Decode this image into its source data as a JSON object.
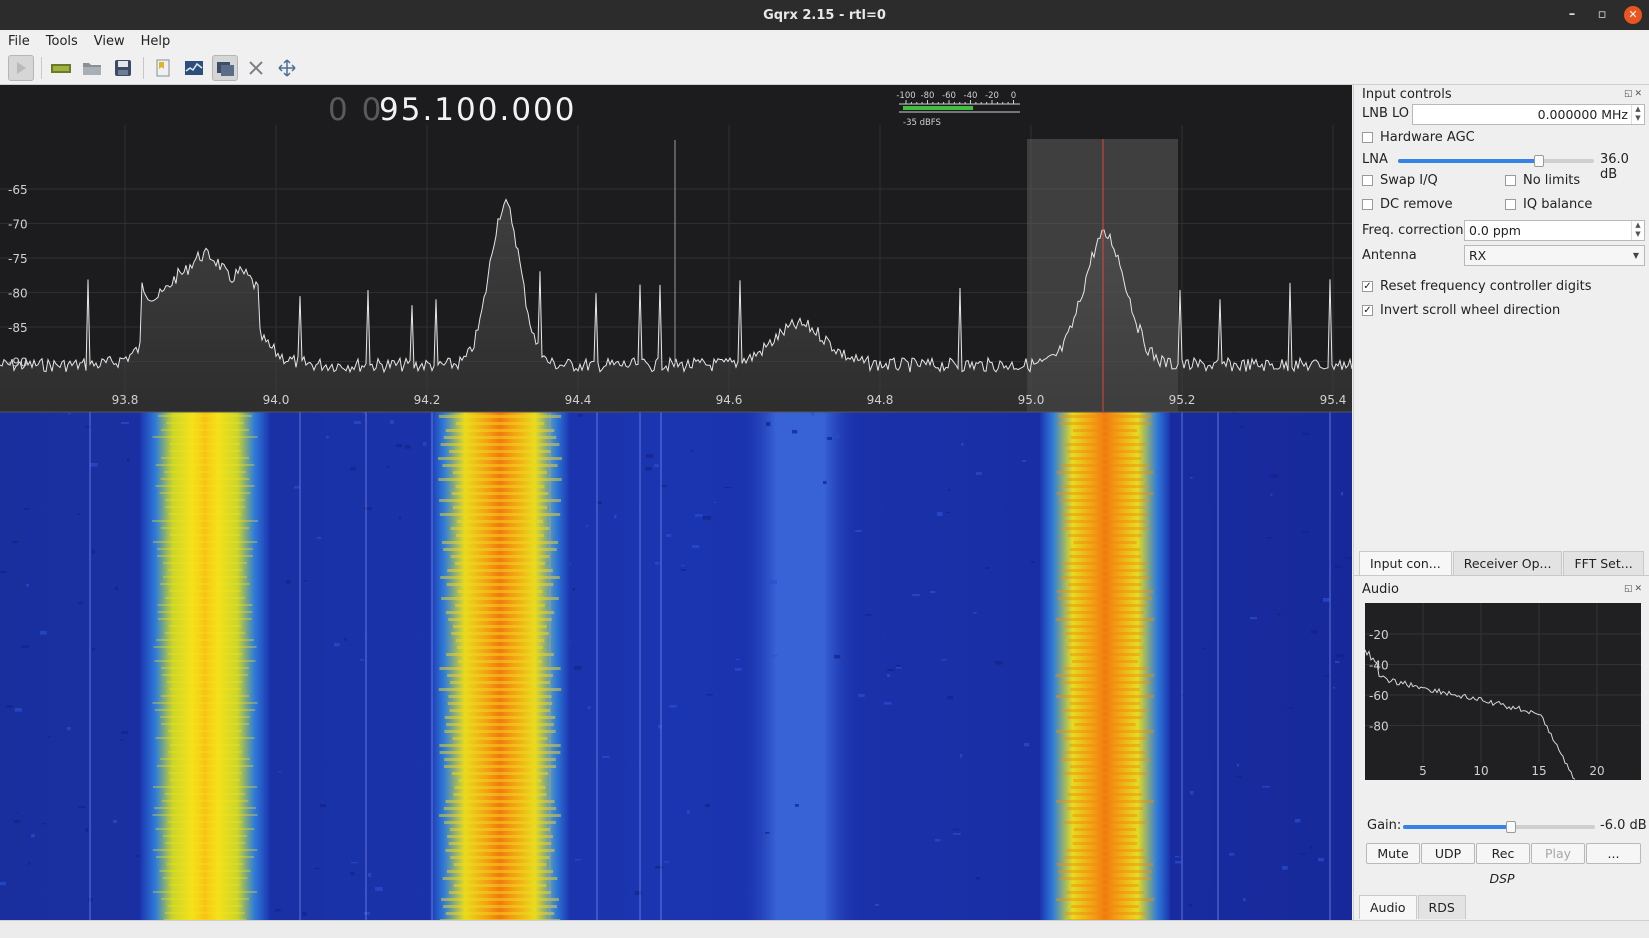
{
  "window": {
    "title": "Gqrx 2.15 - rtl=0"
  },
  "menu": [
    "File",
    "Tools",
    "View",
    "Help"
  ],
  "toolbar": [
    "play-icon",
    "device-icon",
    "open-icon",
    "save-icon",
    "bookmark-icon",
    "fft-icon",
    "remote-icon",
    "tools-icon",
    "fit-icon"
  ],
  "frequency": {
    "dim": "0 0",
    "value": "95.100.000"
  },
  "meter": {
    "scale": [
      "-100",
      "-80",
      "-60",
      "-40",
      "-20",
      "0"
    ],
    "level_text": "-35 dBFS",
    "level_fraction": 0.61
  },
  "spectrum": {
    "y_ticks": [
      "-65",
      "-70",
      "-75",
      "-80",
      "-85",
      "-90"
    ],
    "x_ticks": [
      "93.8",
      "94.0",
      "94.2",
      "94.4",
      "94.6",
      "94.8",
      "95.0",
      "95.2",
      "95.4"
    ]
  },
  "input_controls": {
    "title": "Input controls",
    "lnb_label": "LNB LO",
    "lnb_value": "0.000000 MHz",
    "hardware_agc": "Hardware AGC",
    "lna_label": "LNA",
    "lna_value": "36.0 dB",
    "lna_fraction": 0.72,
    "swap_iq": "Swap I/Q",
    "no_limits": "No limits",
    "dc_remove": "DC remove",
    "iq_balance": "IQ balance",
    "freq_corr_label": "Freq. correction",
    "freq_corr_value": "0.0 ppm",
    "antenna_label": "Antenna",
    "antenna_value": "RX",
    "reset_digits": "Reset frequency controller digits",
    "invert_scroll": "Invert scroll wheel direction",
    "check_mark": "✓"
  },
  "panel_tabs": [
    "Input con...",
    "Receiver Op...",
    "FFT Set..."
  ],
  "audio": {
    "title": "Audio",
    "y_ticks": [
      "-20",
      "-40",
      "-60",
      "-80"
    ],
    "x_ticks": [
      "5",
      "10",
      "15",
      "20"
    ],
    "gain_label": "Gain:",
    "gain_value": "-6.0 dB",
    "gain_fraction": 0.56,
    "buttons": [
      "Mute",
      "UDP",
      "Rec",
      "Play",
      "..."
    ],
    "dsp_label": "DSP",
    "tabs": [
      "Audio",
      "RDS"
    ]
  }
}
